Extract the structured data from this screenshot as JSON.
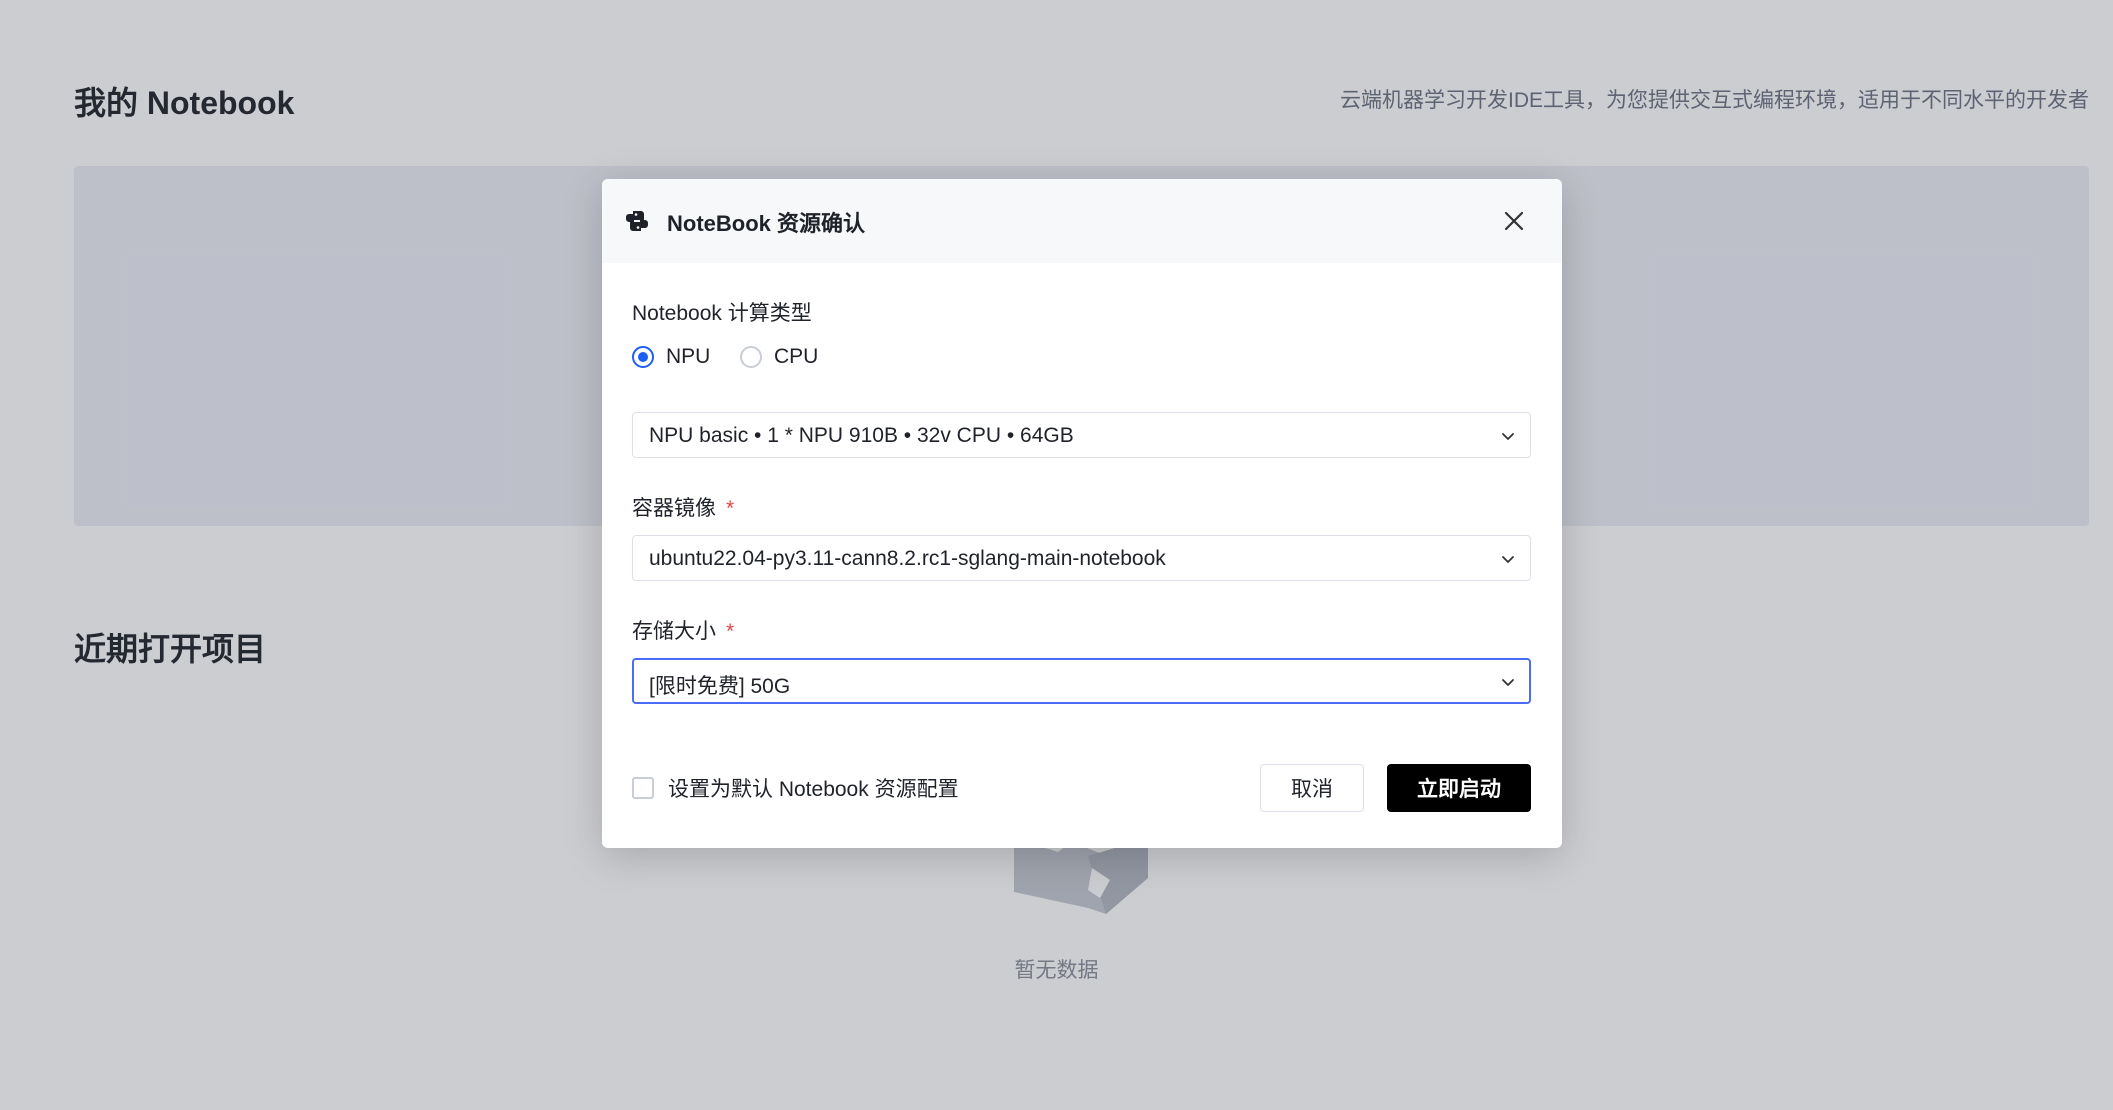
{
  "page": {
    "title": "我的 Notebook",
    "description": "云端机器学习开发IDE工具，为您提供交互式编程环境，适用于不同水平的开发者",
    "recent_title": "近期打开项目",
    "empty_text": "暂无数据"
  },
  "modal": {
    "title": "NoteBook 资源确认",
    "compute_type_label": "Notebook 计算类型",
    "compute_options": [
      {
        "label": "NPU",
        "selected": true
      },
      {
        "label": "CPU",
        "selected": false
      }
    ],
    "spec_value": "NPU basic  •  1 * NPU 910B  •  32v CPU  •  64GB",
    "image_label": "容器镜像",
    "image_value": "ubuntu22.04-py3.11-cann8.2.rc1-sglang-main-notebook",
    "storage_label": "存储大小",
    "storage_value": "[限时免费] 50G",
    "required_mark": "*",
    "default_checkbox_label": "设置为默认 Notebook 资源配置",
    "default_checked": false,
    "cancel_label": "取消",
    "start_label": "立即启动"
  },
  "colors": {
    "accent": "#1d5ef5",
    "required": "#e54545",
    "primary_button": "#000000"
  },
  "icons": {
    "logo": "python-logo-icon",
    "close": "close-icon",
    "dropdown": "chevron-down-icon",
    "empty": "empty-box-icon"
  }
}
